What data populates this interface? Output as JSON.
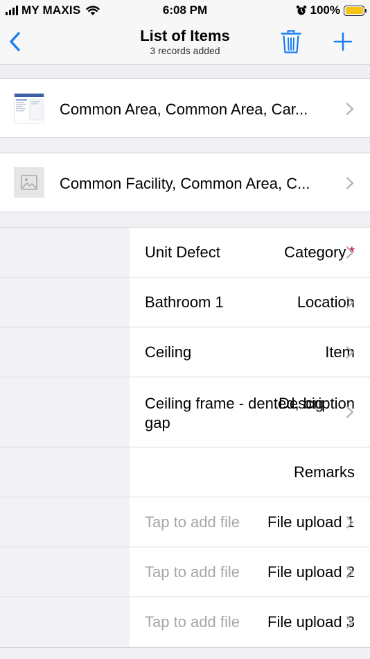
{
  "status_bar": {
    "carrier": "MY MAXIS",
    "time": "6:08 PM",
    "battery": "100%"
  },
  "nav": {
    "title": "List of Items",
    "subtitle": "3 records added",
    "back_icon": "chevron-left-icon",
    "delete_icon": "trash-icon",
    "add_icon": "plus-icon",
    "accent_color": "#1a7cf5"
  },
  "records": [
    {
      "text": "Common Area, Common Area, Car...",
      "thumb": "document-thumbnail"
    },
    {
      "text": "Common Facility, Common Area, C...",
      "thumb": "image-placeholder-icon"
    }
  ],
  "form": {
    "category": {
      "label": "Category",
      "required_mark": "*",
      "value": "Unit Defect"
    },
    "location": {
      "label": "Location",
      "value": "Bathroom 1"
    },
    "item": {
      "label": "Item",
      "value": "Ceiling"
    },
    "description": {
      "label": "Description",
      "value": "Ceiling frame - dented, big gap"
    },
    "remarks": {
      "label": "Remarks",
      "value": ""
    },
    "file_upload_1": {
      "label": "File upload 1",
      "placeholder": "Tap to add file"
    },
    "file_upload_2": {
      "label": "File upload 2",
      "placeholder": "Tap to add file"
    },
    "file_upload_3": {
      "label": "File upload 3",
      "placeholder": "Tap to add file"
    }
  }
}
